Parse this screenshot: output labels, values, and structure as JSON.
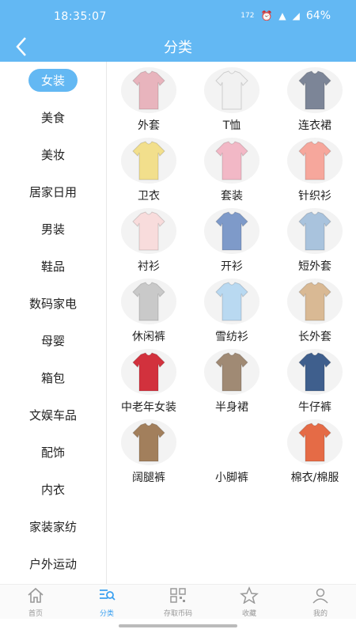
{
  "status": {
    "time": "18:35:07",
    "network": "172",
    "battery": "64%"
  },
  "header": {
    "title": "分类"
  },
  "sidebar": {
    "items": [
      {
        "label": "女装",
        "active": true
      },
      {
        "label": "美食"
      },
      {
        "label": "美妆"
      },
      {
        "label": "居家日用"
      },
      {
        "label": "男装"
      },
      {
        "label": "鞋品"
      },
      {
        "label": "数码家电"
      },
      {
        "label": "母婴"
      },
      {
        "label": "箱包"
      },
      {
        "label": "文娱车品"
      },
      {
        "label": "配饰"
      },
      {
        "label": "内衣"
      },
      {
        "label": "家装家纺"
      },
      {
        "label": "户外运动"
      }
    ]
  },
  "categories": [
    {
      "label": "外套",
      "icon": "pink-jacket-icon",
      "color": "#e8b4bd"
    },
    {
      "label": "T恤",
      "icon": "white-tshirt-icon",
      "color": "#f1f1f1"
    },
    {
      "label": "连衣裙",
      "icon": "dress-icon",
      "color": "#7c8597"
    },
    {
      "label": "卫衣",
      "icon": "hoodie-icon",
      "color": "#f2df8c"
    },
    {
      "label": "套装",
      "icon": "set-outfit-icon",
      "color": "#f2b8c6"
    },
    {
      "label": "针织衫",
      "icon": "cardigan-icon",
      "color": "#f6a79c"
    },
    {
      "label": "衬衫",
      "icon": "shirt-icon",
      "color": "#f8dcdc"
    },
    {
      "label": "开衫",
      "icon": "knit-cardigan-icon",
      "color": "#7e9ac9"
    },
    {
      "label": "短外套",
      "icon": "denim-jacket-icon",
      "color": "#a9c3dd"
    },
    {
      "label": "休闲裤",
      "icon": "casual-pants-icon",
      "color": "#c9c9c9"
    },
    {
      "label": "雪纺衫",
      "icon": "chiffon-blouse-icon",
      "color": "#b9d9f1"
    },
    {
      "label": "长外套",
      "icon": "trench-coat-icon",
      "color": "#d9b994"
    },
    {
      "label": "中老年女装",
      "icon": "padded-coat-icon",
      "color": "#d2313d"
    },
    {
      "label": "半身裙",
      "icon": "skirt-icon",
      "color": "#a08a74"
    },
    {
      "label": "牛仔裤",
      "icon": "jeans-icon",
      "color": "#3f5f8d"
    },
    {
      "label": "阔腿裤",
      "icon": "wide-pants-icon",
      "color": "#a27f5c"
    },
    {
      "label": "小脚裤",
      "icon": "",
      "color": ""
    },
    {
      "label": "棉衣/棉服",
      "icon": "cotton-coat-icon",
      "color": "#e56b46"
    }
  ],
  "tabbar": {
    "items": [
      {
        "label": "首页",
        "icon": "home-icon"
      },
      {
        "label": "分类",
        "icon": "category-icon",
        "active": true
      },
      {
        "label": "存取币码",
        "icon": "qrcode-icon"
      },
      {
        "label": "收藏",
        "icon": "star-icon"
      },
      {
        "label": "我的",
        "icon": "user-icon"
      }
    ]
  }
}
